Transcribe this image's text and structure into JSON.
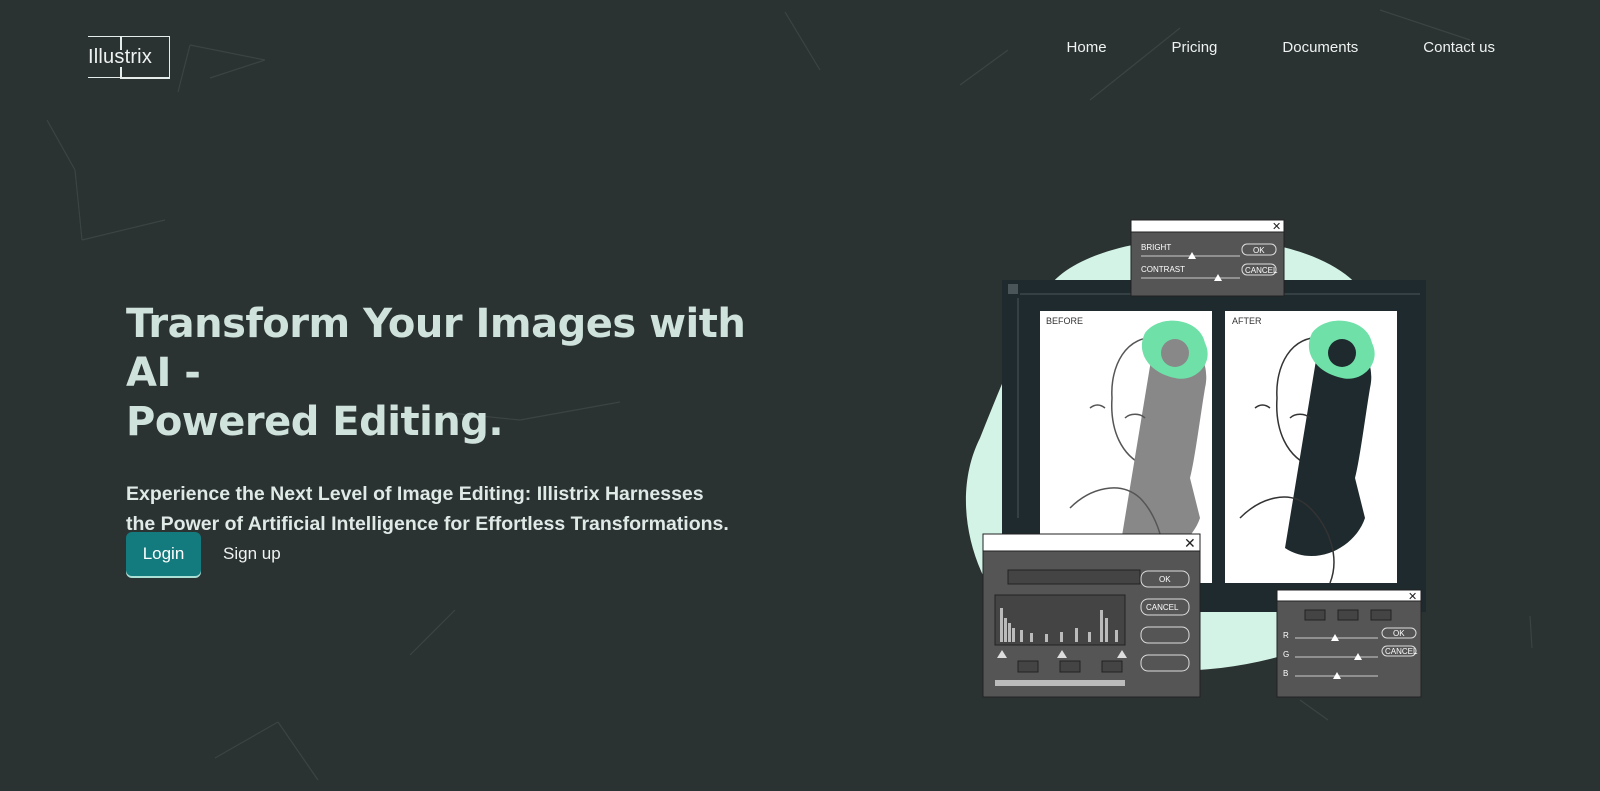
{
  "brand": {
    "logo_text": "Illustrix"
  },
  "nav": {
    "items": [
      {
        "label": "Home"
      },
      {
        "label": "Pricing"
      },
      {
        "label": "Documents"
      },
      {
        "label": "Contact us"
      }
    ]
  },
  "hero": {
    "title_line1": "Transform Your Images with AI -",
    "title_line2": "Powered Editing.",
    "subtitle_line1": "Experience the Next Level of Image Editing: Illistrix Harnesses",
    "subtitle_line2": "the Power of Artificial Intelligence for Effortless Transformations."
  },
  "actions": {
    "login_label": "Login",
    "signup_label": "Sign up"
  },
  "illustration": {
    "before_label": "BEFORE",
    "after_label": "AFTER",
    "bright_label": "BRIGHT",
    "contrast_label": "CONTRAST",
    "ok_label": "OK",
    "cancel_label": "CANCEL",
    "r_label": "R",
    "g_label": "G",
    "b_label": "B"
  },
  "colors": {
    "background": "#2b3232",
    "accent": "#137a7d",
    "mint": "#d2f3e5",
    "leaf": "#6ee0a8"
  }
}
